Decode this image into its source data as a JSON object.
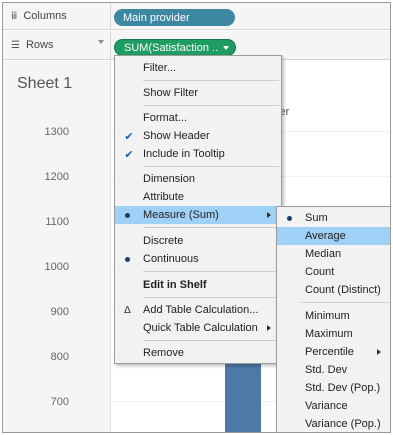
{
  "shelves": {
    "columns": {
      "label": "Columns",
      "icon": "columns-icon",
      "pill": "Main provider",
      "pill_color": "#3d87a3"
    },
    "rows": {
      "label": "Rows",
      "icon": "rows-icon",
      "pill": "SUM(Satisfaction ..",
      "pill_color": "#1e9c62"
    }
  },
  "sheet": {
    "title": "Sheet 1",
    "header_fragment": "ider",
    "axis_ticks": [
      "1300",
      "1200",
      "1100",
      "1000",
      "900",
      "800",
      "700"
    ],
    "bar_color": "#4e79a7"
  },
  "context_menu": {
    "items": [
      {
        "label": "Filter..."
      },
      {
        "label": "Show Filter"
      },
      {
        "label": "Format..."
      },
      {
        "label": "Show Header",
        "checked": true
      },
      {
        "label": "Include in Tooltip",
        "checked": true
      },
      {
        "label": "Dimension"
      },
      {
        "label": "Attribute"
      },
      {
        "label": "Measure (Sum)",
        "selected": true,
        "submenu": true,
        "highlighted": true
      },
      {
        "label": "Discrete"
      },
      {
        "label": "Continuous",
        "selected": true
      },
      {
        "label": "Edit in Shelf",
        "bold": true
      },
      {
        "label": "Add Table Calculation...",
        "icon": "delta-icon"
      },
      {
        "label": "Quick Table Calculation",
        "submenu": true
      },
      {
        "label": "Remove"
      }
    ]
  },
  "measure_submenu": {
    "items": [
      {
        "label": "Sum",
        "selected": true
      },
      {
        "label": "Average",
        "highlighted": true
      },
      {
        "label": "Median"
      },
      {
        "label": "Count"
      },
      {
        "label": "Count (Distinct)"
      },
      {
        "label": "Minimum"
      },
      {
        "label": "Maximum"
      },
      {
        "label": "Percentile",
        "submenu": true
      },
      {
        "label": "Std. Dev"
      },
      {
        "label": "Std. Dev (Pop.)"
      },
      {
        "label": "Variance"
      },
      {
        "label": "Variance (Pop.)"
      }
    ]
  },
  "colors": {
    "highlight": "#9fd0f5",
    "menu_bg": "#f2f2f2"
  }
}
